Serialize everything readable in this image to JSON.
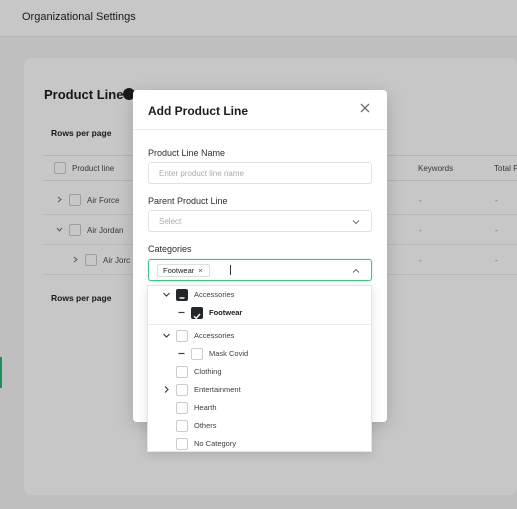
{
  "page": {
    "title": "Organizational Settings"
  },
  "card": {
    "title": "Product Line",
    "rows_per_page_label": "Rows per page",
    "columns": [
      "Product line",
      "Keywords",
      "Total P"
    ],
    "rows": [
      {
        "name": "Air Force",
        "keywords": "-",
        "total": "-"
      },
      {
        "name": "Air Jordan",
        "keywords": "-",
        "total": "-"
      },
      {
        "name": "Air Jorc",
        "keywords": "-",
        "total": "-"
      }
    ]
  },
  "modal": {
    "title": "Add Product Line",
    "name_label": "Product Line Name",
    "name_placeholder": "Enter product line name",
    "parent_label": "Parent Product Line",
    "parent_placeholder": "Select",
    "categories_label": "Categories",
    "selected_chip": "Footwear",
    "chip_remove": "×"
  },
  "tree": {
    "selected": [
      {
        "label": "Accessories",
        "state": "indeterminate"
      },
      {
        "label": "Footwear",
        "state": "checked"
      }
    ],
    "options": [
      {
        "label": "Accessories"
      },
      {
        "label": "Mask Covid"
      },
      {
        "label": "Clothing"
      },
      {
        "label": "Entertainment"
      },
      {
        "label": "Hearth"
      },
      {
        "label": "Others"
      },
      {
        "label": "No Category"
      }
    ]
  },
  "colors": {
    "accent": "#45c58a",
    "checkbox_dark": "#23272c"
  }
}
